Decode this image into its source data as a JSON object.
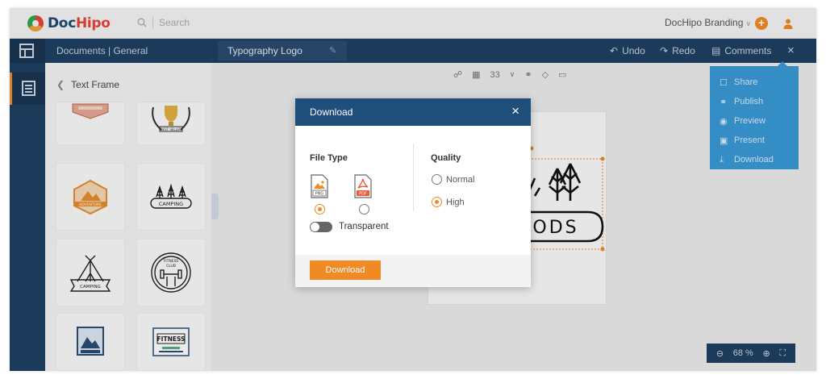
{
  "app": {
    "name_part1": "Doc",
    "name_part2": "Hipo"
  },
  "search": {
    "placeholder": "Search"
  },
  "header": {
    "brand_menu": "DocHipo Branding",
    "plus": "+"
  },
  "navbar": {
    "breadcrumb": "Documents | General",
    "doc_title": "Typography Logo",
    "undo": "Undo",
    "redo": "Redo",
    "comments": "Comments"
  },
  "panel": {
    "title": "Text Frame"
  },
  "canvas_toolbar": {
    "position_value": "33"
  },
  "page_preview": {
    "text": "ODS"
  },
  "share_menu": [
    {
      "label": "Share",
      "icon": "lock-icon"
    },
    {
      "label": "Publish",
      "icon": "share-nodes-icon"
    },
    {
      "label": "Preview",
      "icon": "eye-icon"
    },
    {
      "label": "Present",
      "icon": "present-icon"
    },
    {
      "label": "Download",
      "icon": "download-icon"
    }
  ],
  "zoom": {
    "value": "68 %"
  },
  "modal": {
    "title": "Download",
    "file_type_label": "File Type",
    "file_types": [
      {
        "name": "PNG",
        "selected": true
      },
      {
        "name": "PDF",
        "selected": false
      }
    ],
    "quality_label": "Quality",
    "quality_options": [
      {
        "name": "Normal",
        "selected": false
      },
      {
        "name": "High",
        "selected": true
      }
    ],
    "transparent_label": "Transparent",
    "transparent_on": false,
    "download_button": "Download"
  },
  "colors": {
    "accent": "#f08a24",
    "navy": "#1f3f61",
    "modal_header": "#1f4e7a",
    "share_menu": "#3a9ad6"
  },
  "templates": {
    "row1a_text": "",
    "row1b_text": "BEST SELLER",
    "row2a_text": "ADVENTURE",
    "row2b_text": "CAMPING",
    "row3a_text": "CAMPING",
    "row3b_top": "FITNESS",
    "row3b_mid": "CLUB",
    "row4b_text": "FITNESS"
  }
}
